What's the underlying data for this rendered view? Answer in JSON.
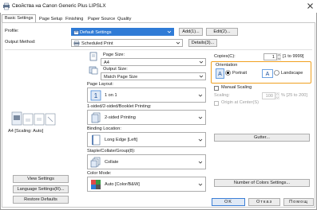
{
  "window": {
    "title": "Свойства на Canon Generic Plus LIPSLX"
  },
  "tabs": [
    "Basic Settings",
    "Page Setup",
    "Finishing",
    "Paper Source",
    "Quality"
  ],
  "left": {
    "profile_label": "Profile:",
    "profile_value": "Default Settings",
    "add_button": "Add(1)...",
    "edit_button": "Edit(2)...",
    "output_label": "Output Method:",
    "output_value": "Scheduled Print",
    "details_button": "Details(3)...",
    "preview_caption": "A4 [Scaling: Auto]",
    "view_settings": "View Settings",
    "language_settings": "Language Settings(R)...",
    "restore_defaults": "Restore Defaults"
  },
  "middle": {
    "page_size_label": "Page Size:",
    "page_size_value": "A4",
    "output_size_label": "Output Size:",
    "output_size_value": "Match Page Size",
    "page_layout_label": "Page Layout:",
    "page_layout_value": "1 on 1",
    "sided_label": "1-sided/2-sided/Booklet Printing:",
    "sided_value": "2-sided Printing",
    "binding_label": "Binding Location:",
    "binding_value": "Long Edge [Left]",
    "staple_label": "Staple/Collate/Group(8):",
    "staple_value": "Collate",
    "color_label": "Color Mode:",
    "color_value": "Auto [Color/B&W]"
  },
  "right": {
    "copies_label": "Copies(C):",
    "copies_value": "1",
    "copies_range": "[1 to 9999]",
    "orientation_label": "Orientation",
    "portrait_label": "Portrait",
    "landscape_label": "Landscape",
    "manual_scaling_label": "Manual Scaling",
    "scaling_label": "Scaling:",
    "scaling_value": "100",
    "scaling_range": "% [25 to 200]",
    "origin_label": "Origin at Center(S)",
    "gutter_button": "Gutter...",
    "color_settings_button": "Number of Colors Settings..."
  },
  "footer": {
    "ok": "OK",
    "cancel": "Отказ",
    "help": "Помощ"
  },
  "colors": {
    "orientation_highlight": "#f0a020",
    "profile_selected_bg": "#2f7bd6",
    "accent_blue": "#2f7bd6"
  }
}
